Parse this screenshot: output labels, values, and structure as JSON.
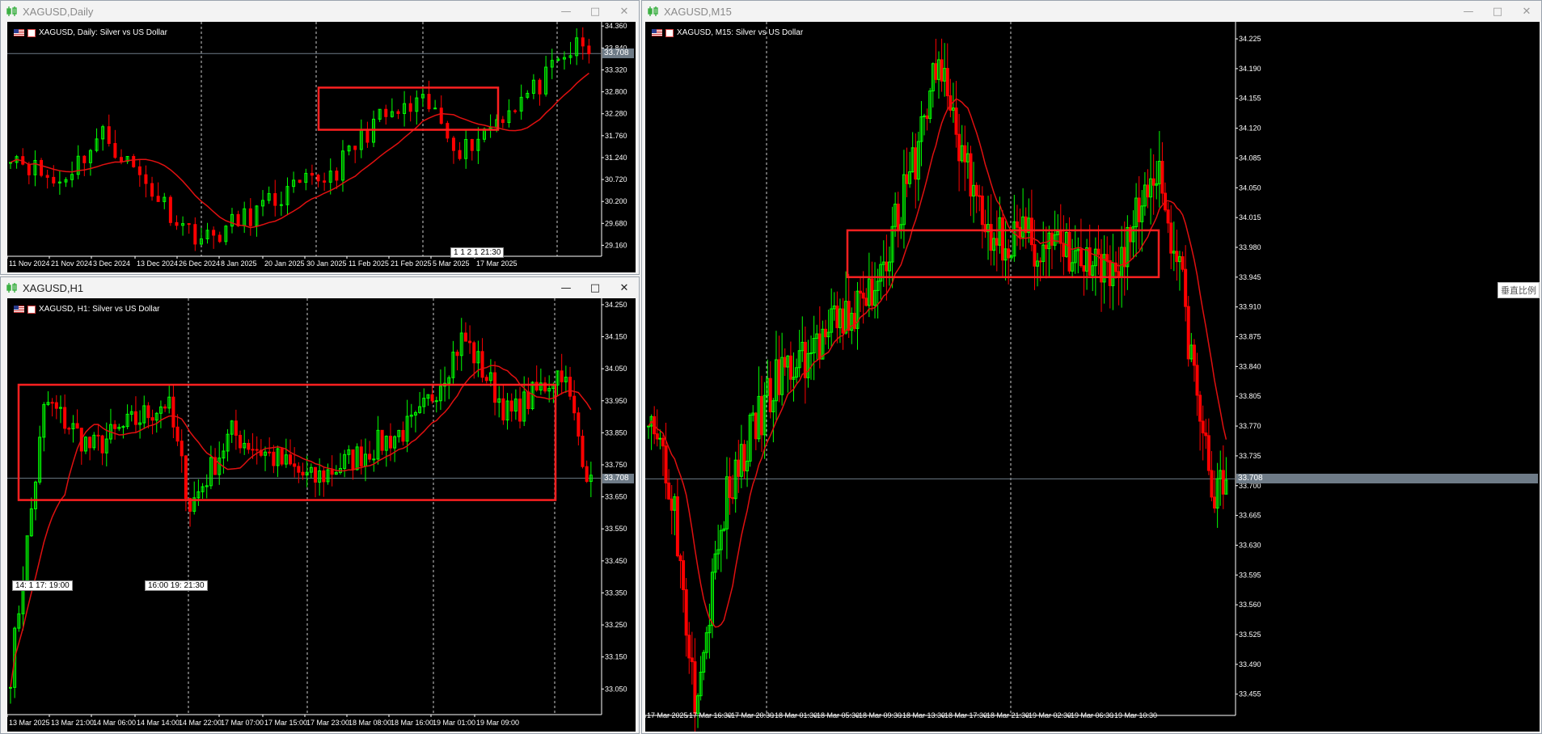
{
  "windows": [
    {
      "id": "daily",
      "title": "XAGUSD,Daily",
      "active": false,
      "symbol_label": "XAGUSD, Daily:  Silver vs US Dollar",
      "current_price": "33.708",
      "time_scroll_tag": "1 1 2 1 21:30",
      "chart_data": {
        "type": "candlestick",
        "title": "XAGUSD, Daily:  Silver vs US Dollar",
        "y_ticks": [
          "34.360",
          "33.840",
          "33.320",
          "32.800",
          "32.280",
          "31.760",
          "31.240",
          "30.720",
          "30.200",
          "29.680",
          "29.160"
        ],
        "x_labels": [
          "11 Nov 2024",
          "21 Nov 2024",
          "3 Dec 2024",
          "13 Dec 2024",
          "26 Dec 2024",
          "8 Jan 2025",
          "20 Jan 2025",
          "30 Jan 2025",
          "11 Feb 2025",
          "21 Feb 2025",
          "5 Mar 2025",
          "17 Mar 2025"
        ],
        "ylim": [
          28.9,
          34.46
        ],
        "last_price": 33.708,
        "grid": "vertical dashed period separators",
        "moving_average": "red line",
        "annotation_box": {
          "price_range": [
            31.9,
            32.9
          ]
        }
      }
    },
    {
      "id": "h1",
      "title": "XAGUSD,H1",
      "active": true,
      "symbol_label": "XAGUSD, H1:  Silver vs US Dollar",
      "current_price": "33.708",
      "time_scroll_tags": [
        "14: 1 17: 19:00",
        "16:00 19: 21:30"
      ],
      "chart_data": {
        "type": "candlestick",
        "title": "XAGUSD, H1:  Silver vs US Dollar",
        "y_ticks": [
          "34.250",
          "34.150",
          "34.050",
          "33.950",
          "33.850",
          "33.750",
          "33.650",
          "33.550",
          "33.450",
          "33.350",
          "33.250",
          "33.150",
          "33.050"
        ],
        "x_labels": [
          "13 Mar 2025",
          "13 Mar 21:00",
          "14 Mar 06:00",
          "14 Mar 14:00",
          "14 Mar 22:00",
          "17 Mar 07:00",
          "17 Mar 15:00",
          "17 Mar 23:00",
          "18 Mar 08:00",
          "18 Mar 16:00",
          "19 Mar 01:00",
          "19 Mar 09:00"
        ],
        "ylim": [
          32.97,
          34.27
        ],
        "last_price": 33.708,
        "grid": "vertical dashed period separators",
        "moving_average": "red line",
        "annotation_box": {
          "price_range": [
            33.64,
            34.0
          ]
        }
      }
    },
    {
      "id": "m15",
      "title": "XAGUSD,M15",
      "active": false,
      "symbol_label": "XAGUSD, M15:  Silver vs US Dollar",
      "current_price": "33.708",
      "side_tag": "垂直比例",
      "chart_data": {
        "type": "candlestick",
        "title": "XAGUSD, M15:  Silver vs US Dollar",
        "y_ticks": [
          "34.225",
          "34.190",
          "34.155",
          "34.120",
          "34.085",
          "34.050",
          "34.015",
          "33.980",
          "33.945",
          "33.910",
          "33.875",
          "33.840",
          "33.805",
          "33.770",
          "33.735",
          "33.700",
          "33.665",
          "33.630",
          "33.595",
          "33.560",
          "33.525",
          "33.490",
          "33.455"
        ],
        "x_labels": [
          "17 Mar 2025",
          "17 Mar 16:30",
          "17 Mar 20:30",
          "18 Mar 01:30",
          "18 Mar 05:30",
          "18 Mar 09:30",
          "18 Mar 13:30",
          "18 Mar 17:30",
          "18 Mar 21:30",
          "19 Mar 02:30",
          "19 Mar 06:30",
          "19 Mar 10:30"
        ],
        "ylim": [
          33.43,
          34.245
        ],
        "last_price": 33.708,
        "grid": "vertical dashed period separators",
        "moving_average": "red line",
        "annotation_box": {
          "price_range": [
            33.945,
            34.0
          ]
        }
      }
    }
  ],
  "colors": {
    "bull": "#00ff00",
    "bear": "#ff0000",
    "ma": "#e01010",
    "box": "#ff2020",
    "grid": "#ffffff",
    "axis_text": "#ffffff",
    "price_line": "#6e7b87"
  }
}
